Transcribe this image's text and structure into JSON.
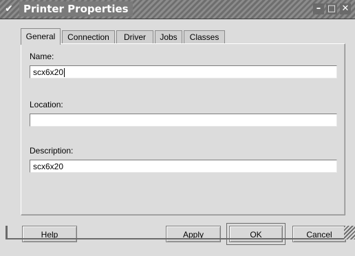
{
  "window": {
    "title": "Printer Properties",
    "controls": {
      "menu": "✔",
      "minimize": "–",
      "maximize": "□",
      "close": "✕"
    }
  },
  "tabs": [
    {
      "label": "General",
      "active": true
    },
    {
      "label": "Connection",
      "active": false
    },
    {
      "label": "Driver",
      "active": false
    },
    {
      "label": "Jobs",
      "active": false
    },
    {
      "label": "Classes",
      "active": false
    }
  ],
  "form": {
    "name_label": "Name:",
    "name_value": "scx6x20",
    "location_label": "Location:",
    "location_value": "",
    "description_label": "Description:",
    "description_value": "scx6x20"
  },
  "buttons": {
    "help": {
      "mnemonic": "H",
      "rest": "elp"
    },
    "apply": {
      "mnemonic": "A",
      "rest": "pply"
    },
    "ok": {
      "mnemonic": "O",
      "rest": "K"
    },
    "cancel": {
      "mnemonic": "C",
      "rest": "ancel"
    }
  }
}
